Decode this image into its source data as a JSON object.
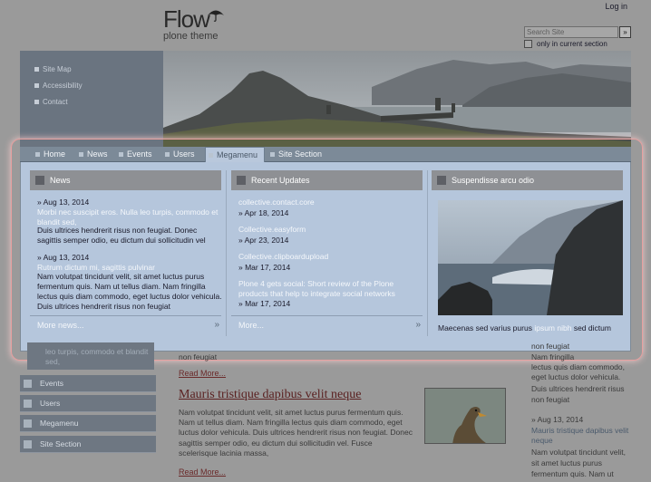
{
  "site": {
    "logo_title": "Flow",
    "logo_subtitle": "plone theme",
    "login": "Log in"
  },
  "search": {
    "placeholder": "Search Site",
    "button": "»",
    "checkbox_label": "only in current section"
  },
  "utility_links": [
    "Site Map",
    "Accessibility",
    "Contact"
  ],
  "nav": {
    "tabs": [
      "Home",
      "News",
      "Events",
      "Users",
      "Megamenu",
      "Site Section"
    ],
    "active": "Megamenu"
  },
  "mega": {
    "news": {
      "heading": "News",
      "items": [
        {
          "date": "Aug 13, 2014",
          "title": "Morbi nec suscipit eros. Nulla leo turpis, commodo et blandit sed,",
          "body": "Duis ultrices hendrerit risus non feugiat. Donec sagittis semper odio, eu dictum dui sollicitudin vel"
        },
        {
          "date": "Aug 13, 2014",
          "title": "Rutrum dictum mi, sagittis pulvinar",
          "body": "Nam volutpat tincidunt velit, sit amet luctus purus fermentum quis. Nam ut tellus diam. Nam fringilla lectus quis diam commodo, eget luctus dolor vehicula. Duis ultrices hendrerit risus non feugiat"
        }
      ],
      "more": "More news..."
    },
    "updates": {
      "heading": "Recent Updates",
      "items": [
        {
          "title": "collective.contact.core",
          "date": "Apr 18, 2014"
        },
        {
          "title": "Collective.easyform",
          "date": "Apr 23, 2014"
        },
        {
          "title": "Collective.clipboardupload",
          "date": "Mar 17, 2014"
        },
        {
          "title": "Plone 4 gets social: Short review of the Plone products that help to integrate social networks",
          "date": "Mar 17, 2014"
        }
      ],
      "more": "More..."
    },
    "feature": {
      "heading": "Suspendisse arcu odio",
      "caption_pre": "Maecenas sed varius purus",
      "caption_link": "ipsum nibh",
      "caption_post": "sed dictum"
    }
  },
  "left_menu": {
    "partial": [
      "leo turpis, commodo et blandit",
      "sed,"
    ],
    "items": [
      "Events",
      "Users",
      "Megamenu",
      "Site Section"
    ]
  },
  "content": {
    "feugiat_line": "non feugiat",
    "read_more": "Read More...",
    "article2": {
      "title": "Mauris tristique dapibus velit neque",
      "body_lines": [
        "Nam volutpat tincidunt velit, sit amet luctus purus fermentum quis.",
        "Nam ut tellus diam. Nam fringilla lectus quis diam commodo, eget",
        "luctus dolor vehicula. Duis ultrices hendrerit risus non feugiat. Donec",
        "sagittis semper odio, eu dictum dui sollicitudin vel. Fusce",
        "scelerisque lacinia massa,"
      ]
    },
    "read_more_2": "Read More..."
  },
  "right_column": {
    "top_lines": [
      "non feugiat",
      "Nam fringilla",
      "lectus quis diam commodo,",
      "eget luctus dolor vehicula.",
      "Duis ultrices hendrerit risus",
      "non feugiat"
    ],
    "date": "Aug 13, 2014",
    "title_lines": [
      "Mauris tristique dapibus velit",
      "neque"
    ],
    "body_lines": [
      "Nam volutpat tincidunt velit,",
      "sit amet luctus purus",
      "fermentum quis. Nam ut"
    ]
  }
}
